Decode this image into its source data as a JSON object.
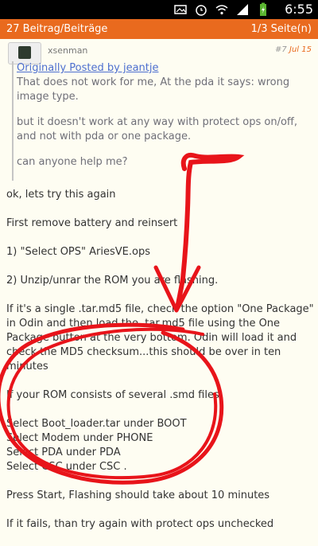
{
  "status_bar": {
    "time": "6:55",
    "icons": [
      "image-icon",
      "alarm-icon",
      "wifi-icon",
      "signal-icon",
      "battery-icon"
    ]
  },
  "app_bar": {
    "left": "27 Beitrag/Beiträge",
    "right": "1/3 Seite(n)"
  },
  "post": {
    "username": "xsenman",
    "number": "#7",
    "date": "Jul 15",
    "quote": {
      "link": "Originally Posted by jeantje",
      "paragraphs": [
        "That does not work for me, At the pda it says: wrong image type.",
        "but it doesn't work at any way with protect ops on/off, and not with pda or one package.",
        "can anyone help me?"
      ]
    },
    "body": [
      "ok, lets try this again",
      "First remove battery and reinsert",
      "1) \"Select OPS\" AriesVE.ops",
      "2) Unzip/unrar the ROM you are flashing.",
      "If it's a single .tar.md5 file, check the option \"One Package\" in Odin and then load the .tar.md5 file using the One Package button at the very bottom. Odin will load it and check the MD5 checksum...this should be over in ten minutes",
      "If your ROM consists of several .smd files",
      "Select Boot_loader.tar under BOOT",
      "Select Modem under PHONE",
      "Select PDA under PDA",
      "Select CSC under CSC .",
      "Press Start, Flashing should take about 10 minutes",
      "If it fails, than try again with protect ops unchecked"
    ]
  },
  "colors": {
    "accent": "#e96a1e",
    "annotation": "#e8141a",
    "link": "#4d6fcf"
  }
}
